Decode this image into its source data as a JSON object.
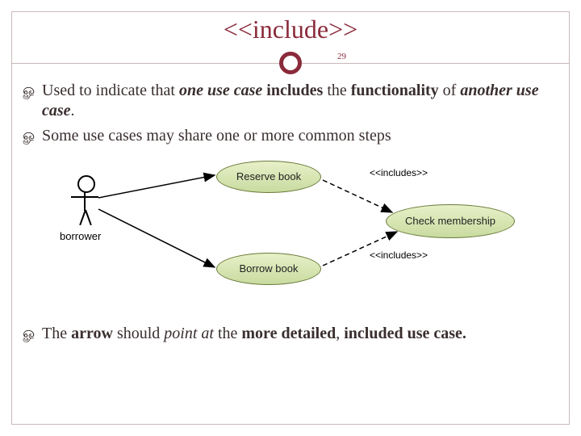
{
  "title": "<<include>>",
  "page_number": "29",
  "bullets": {
    "b1": {
      "pre": "Used to indicate that ",
      "one": "one",
      "space1": " ",
      "use": "use",
      "space2": " ",
      "case": "case",
      "includes": " includes",
      "mid": " the ",
      "func": "functionality",
      "of": " of ",
      "another": "another use case",
      "end": "."
    },
    "b2": "Some use cases may share one or more common steps",
    "b3": {
      "pre": "The ",
      "arrow": "arrow",
      "mid1": " should ",
      "point": "point at",
      "mid2": " the ",
      "more": "more detailed",
      "comma": ", ",
      "inc": "included use case."
    }
  },
  "diagram": {
    "actor": "borrower",
    "reserve": "Reserve book",
    "borrow": "Borrow book",
    "check": "Check membership",
    "includes": "<<includes>>"
  },
  "glyph": "ௐ"
}
